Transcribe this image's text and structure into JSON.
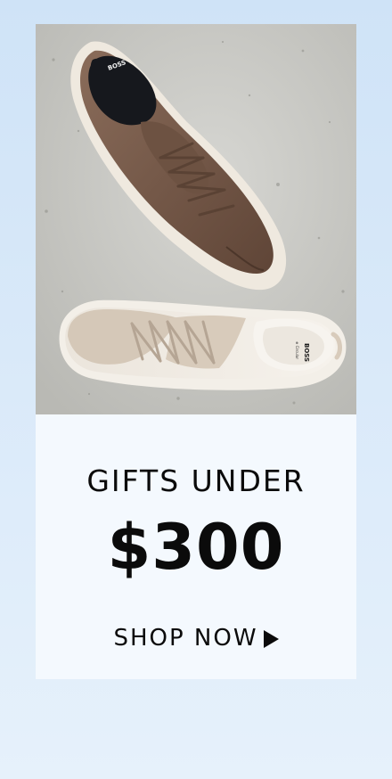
{
  "banner": {
    "headline": "GIFTS UNDER",
    "price": "$300",
    "cta_label": "SHOP NOW",
    "cta_icon": "play-triangle-icon",
    "brand_mark": "BOSS",
    "sub_mark": "⊕ Circular"
  },
  "photo": {
    "subject": "two-sneakers-on-concrete"
  },
  "colors": {
    "page_background_top": "#cfe3f7",
    "page_background_bottom": "#e6f1fb",
    "card_background": "#f4f9fe",
    "text": "#0b0b0b",
    "suede_brown": "#7a5e4d",
    "canvas_beige": "#d8cbbb"
  }
}
